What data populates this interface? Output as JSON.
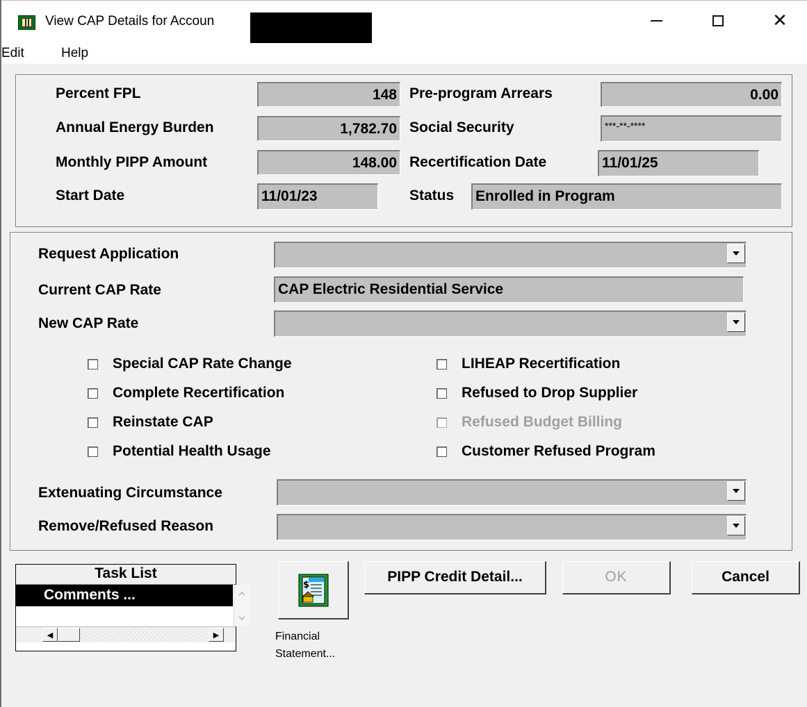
{
  "window": {
    "title": "View CAP Details for Accoun",
    "minimize_label": "minimize",
    "maximize_label": "maximize",
    "close_glyph": "✕"
  },
  "menu": [
    "Edit",
    "Help"
  ],
  "summary": {
    "percent_fpl": {
      "label": "Percent FPL",
      "value": "148"
    },
    "annual_energy_burden": {
      "label": "Annual Energy Burden",
      "value": "1,782.70"
    },
    "monthly_pipp_amount": {
      "label": "Monthly PIPP Amount",
      "value": "148.00"
    },
    "start_date": {
      "label": "Start Date",
      "value": "11/01/23"
    },
    "preprogram_arrears": {
      "label": "Pre-program Arrears",
      "value": "0.00"
    },
    "social_security": {
      "label": "Social Security",
      "value": "***-**-****"
    },
    "recertification_date": {
      "label": "Recertification Date",
      "value": "11/01/25"
    },
    "status": {
      "label": "Status",
      "value": "Enrolled in Program"
    }
  },
  "details": {
    "request_application": {
      "label": "Request Application",
      "value": ""
    },
    "current_cap_rate": {
      "label": "Current CAP Rate",
      "value": "CAP Electric Residential Service"
    },
    "new_cap_rate": {
      "label": "New CAP Rate",
      "value": ""
    },
    "extenuating_circumstance": {
      "label": "Extenuating Circumstance",
      "value": ""
    },
    "remove_refused_reason": {
      "label": "Remove/Refused Reason",
      "value": ""
    }
  },
  "checkboxes_left": [
    {
      "label": "Special CAP Rate Change",
      "checked": false,
      "enabled": true
    },
    {
      "label": "Complete Recertification",
      "checked": false,
      "enabled": true
    },
    {
      "label": "Reinstate CAP",
      "checked": false,
      "enabled": true
    },
    {
      "label": "Potential Health Usage",
      "checked": false,
      "enabled": true
    }
  ],
  "checkboxes_right": [
    {
      "label": "LIHEAP Recertification",
      "checked": false,
      "enabled": true
    },
    {
      "label": "Refused to Drop Supplier",
      "checked": false,
      "enabled": true
    },
    {
      "label": "Refused Budget Billing",
      "checked": false,
      "enabled": false
    },
    {
      "label": "Customer Refused Program",
      "checked": false,
      "enabled": true
    }
  ],
  "task_list": {
    "header": "Task List",
    "items": [
      "Comments ..."
    ]
  },
  "financial_statement": {
    "caption_line1": "Financial",
    "caption_line2": "Statement..."
  },
  "buttons": {
    "pipp_credit_detail": "PIPP Credit Detail...",
    "ok": "OK",
    "cancel": "Cancel"
  }
}
